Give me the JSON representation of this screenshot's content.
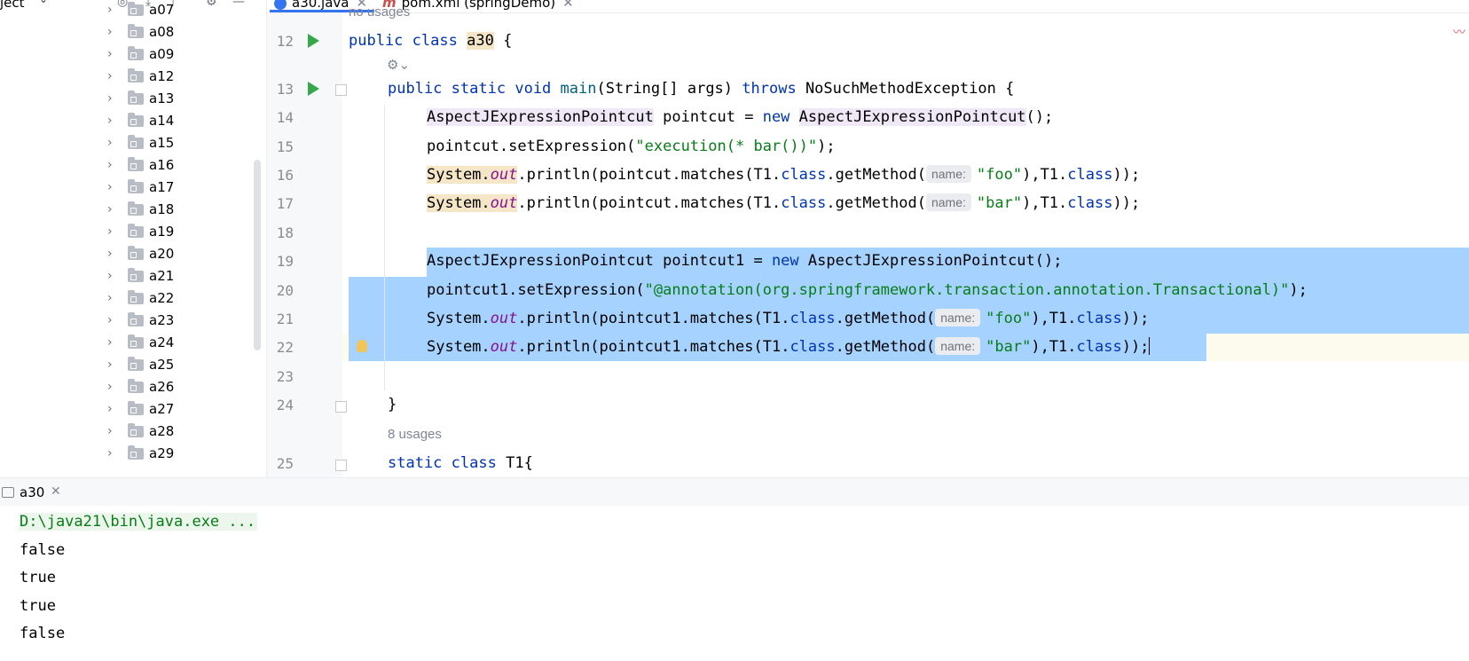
{
  "tree": {
    "project_label": "ject",
    "folders": [
      "a07",
      "a08",
      "a09",
      "a12",
      "a13",
      "a14",
      "a15",
      "a16",
      "a17",
      "a18",
      "a19",
      "a20",
      "a21",
      "a22",
      "a23",
      "a24",
      "a25",
      "a26",
      "a27",
      "a28",
      "a29"
    ]
  },
  "tabs": [
    {
      "label": "a30.java",
      "icon": "java-class-icon",
      "active": true
    },
    {
      "label": "pom.xml (springDemo)",
      "icon": "maven-icon",
      "active": false
    }
  ],
  "editor": {
    "top_usages": "no usages",
    "mid_usages": "8 usages",
    "line_numbers": [
      "12",
      "13",
      "14",
      "15",
      "16",
      "17",
      "18",
      "19",
      "20",
      "21",
      "22",
      "23",
      "24",
      "25"
    ],
    "hint_name": "name:",
    "tokens": {
      "public": "public",
      "class": "class",
      "static": "static",
      "void": "void",
      "throws": "throws",
      "new": "new",
      "class_name": "a30",
      "brace_open": " {",
      "main": "main",
      "main_args": "(String[] args) ",
      "exception": "NoSuchMethodException",
      "ajp": "AspectJExpressionPointcut",
      "l14_mid": " pointcut = ",
      "l14_end": "();",
      "l15_pre": "pointcut.setExpression(",
      "l15_str": "\"execution(* bar())\"",
      "l15_end": ");",
      "system": "System",
      "dot": ".",
      "out": "out",
      "println_pc": ".println(pointcut.matches(T1.",
      "println_pc1": ".println(pointcut1.matches(T1.",
      "getmethod": ".getMethod(",
      "str_foo": "\"foo\"",
      "str_bar": "\"bar\"",
      "t1_tail_a": "),T1.",
      "t1_tail_b": "));",
      "l19_text": "AspectJExpressionPointcut pointcut1 = ",
      "l20_pre": "pointcut1.setExpression(",
      "l20_str": "\"@annotation(org.springframework.transaction.annotation.Transactional)\"",
      "l20_end": ");",
      "close_brace": "}",
      "t1_decl": " T1{"
    }
  },
  "run": {
    "tab_label": "a30",
    "command": "D:\\java21\\bin\\java.exe ...",
    "output": [
      "false",
      "true",
      "true",
      "false"
    ]
  },
  "colors": {
    "keyword": "#0033b3",
    "string": "#067d17",
    "field": "#871094",
    "selection": "#a6d2ff",
    "run_icon": "#35a84a"
  }
}
